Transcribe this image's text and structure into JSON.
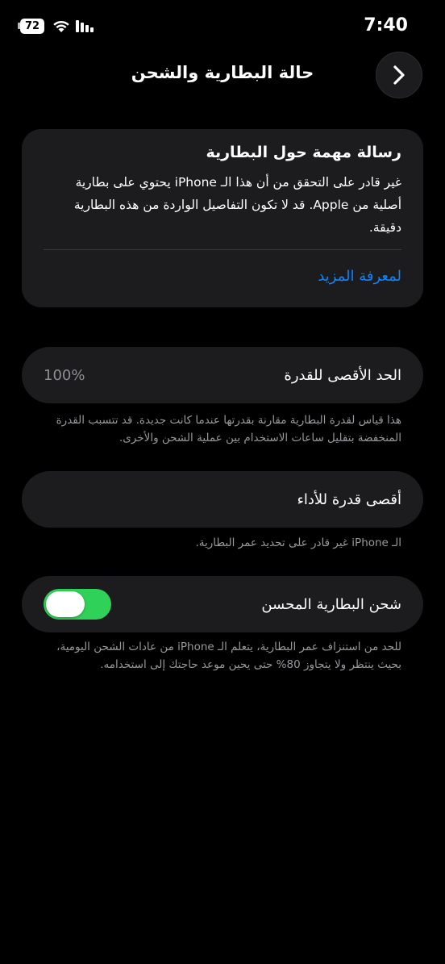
{
  "status_bar": {
    "time": "7:40",
    "battery_level": "72"
  },
  "header": {
    "title": "حالة البطارية والشحن"
  },
  "message": {
    "title": "رسالة مهمة حول البطارية",
    "body": "غير قادر على التحقق من أن هذا الـ iPhone يحتوي على بطارية أصلية من Apple. قد لا تكون التفاصيل الواردة من هذه البطارية دقيقة.",
    "learn_more": "لمعرفة المزيد"
  },
  "capacity": {
    "label": "الحد الأقصى للقدرة",
    "value": "100%",
    "footnote": "هذا قياس لقدرة البطارية مقارنة بقدرتها عندما كانت جديدة. قد تتسبب القدرة المنخفضة بتقليل ساعات الاستخدام بين عملية الشحن والأخرى."
  },
  "performance": {
    "label": "أقصى قدرة للأداء",
    "footnote": "الـ iPhone غير قادر على تحديد عمر البطارية."
  },
  "optimized_charging": {
    "label": "شحن البطارية المحسن",
    "enabled": true,
    "footnote": "للحد من استنزاف عمر البطارية، يتعلم الـ iPhone من عادات الشحن اليومية، بحيث ينتظر ولا يتجاوز 80% حتى يحين موعد حاجتك إلى استخدامه."
  },
  "colors": {
    "background": "#000000",
    "card": "#1c1c1e",
    "accent_link": "#0a84ff",
    "toggle_on": "#30d158",
    "secondary_text": "#98989d"
  },
  "icons": {
    "back": "chevron-right-icon",
    "wifi": "wifi-icon",
    "signal": "cellular-signal-icon",
    "battery": "battery-icon"
  }
}
